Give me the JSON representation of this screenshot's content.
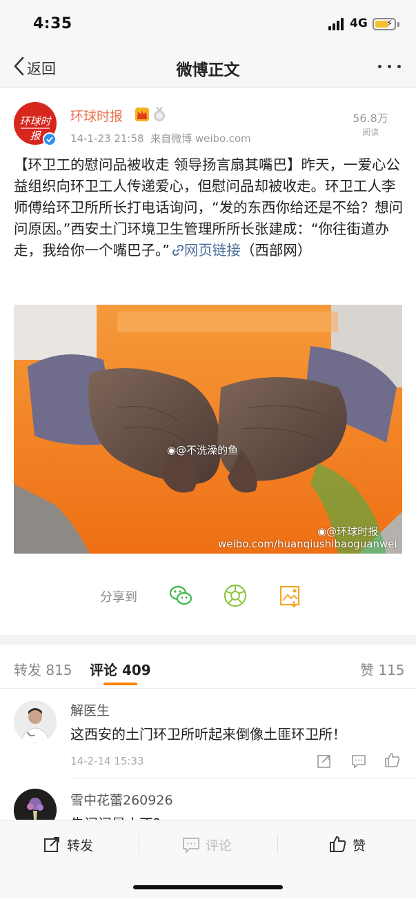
{
  "status_bar": {
    "time": "4:35",
    "network": "4G"
  },
  "nav": {
    "back_label": "返回",
    "title": "微博正文"
  },
  "post": {
    "author": "环球时报",
    "avatar_text": "环球时报",
    "timestamp": "14-1-23 21:58",
    "source": "来自微博 weibo.com",
    "read_count": "56.8万",
    "read_label": "阅读",
    "text_main": "【环卫工的慰问品被收走 领导扬言扇其嘴巴】昨天，一爱心公益组织向环卫工人传递爱心，但慰问品却被收走。环卫工人李师傅给环卫所所长打电话询问，“发的东西你给还是不给？想问问原因。”西安土门环境卫生管理所所长张建成：“你往街道办走，我给你一个嘴巴子。”",
    "link_label": "网页链接",
    "text_tail": "（西部网）",
    "image_watermark_center": "@不洗澡的鱼",
    "image_watermark_corner": "@环球时报",
    "image_watermark_url": "weibo.com/huanqiushibaoguanwei"
  },
  "share": {
    "label": "分享到",
    "icons": [
      "wechat-icon",
      "moments-icon",
      "save-image-icon"
    ]
  },
  "tabs": {
    "repost_label": "转发",
    "repost_count": "815",
    "comment_label": "评论",
    "comment_count": "409",
    "like_label": "赞",
    "like_count": "115"
  },
  "comments": [
    {
      "name": "解医生",
      "text": "这西安的土门环卫所听起来倒像土匪环卫所！",
      "time": "14-2-14 15:33"
    },
    {
      "name": "雪中花蕾260926",
      "text": "告问问是人不?"
    }
  ],
  "toolbar": {
    "repost": "转发",
    "comment": "评论",
    "like": "赞"
  },
  "colors": {
    "accent": "#ff8200",
    "author": "#eb7350",
    "link": "#50709d"
  }
}
